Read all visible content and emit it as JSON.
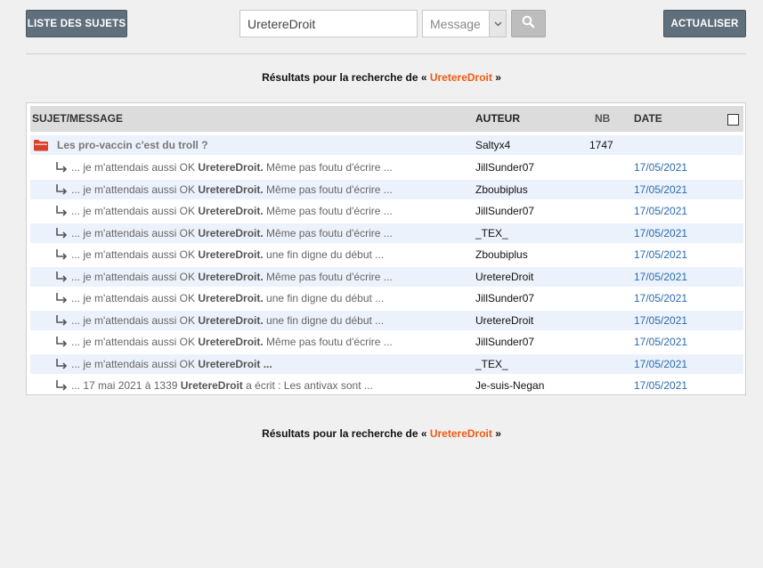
{
  "toolbar": {
    "list_button": "LISTE DES SUJETS",
    "refresh_button": "ACTUALISER",
    "search_value": "UretereDroit",
    "search_mode": "Message",
    "search_icon": "search-icon"
  },
  "results": {
    "prefix": "Résultats pour la recherche de « ",
    "term": "UretereDroit",
    "suffix": " »"
  },
  "table": {
    "headers": {
      "subject": "SUJET/MESSAGE",
      "author": "AUTEUR",
      "nb": "NB",
      "date": "DATE"
    },
    "topic": {
      "title": "Les pro-vaccin c'est du troll ?",
      "author": "Saltyx4",
      "nb": "1747"
    },
    "rows": [
      {
        "pre": "... je m'attendais aussi OK ",
        "bold": "UretereDroit.",
        "post": " Même pas foutu d'écrire ...",
        "author": "JillSunder07",
        "date": "17/05/2021"
      },
      {
        "pre": "... je m'attendais aussi OK ",
        "bold": "UretereDroit.",
        "post": " Même pas foutu d'écrire ...",
        "author": "Zboubiplus",
        "date": "17/05/2021"
      },
      {
        "pre": "... je m'attendais aussi OK ",
        "bold": "UretereDroit.",
        "post": " Même pas foutu d'écrire ...",
        "author": "JillSunder07",
        "date": "17/05/2021"
      },
      {
        "pre": "... je m'attendais aussi OK ",
        "bold": "UretereDroit.",
        "post": " Même pas foutu d'écrire ...",
        "author": "_TEX_",
        "date": "17/05/2021"
      },
      {
        "pre": "... je m'attendais aussi OK ",
        "bold": "UretereDroit.",
        "post": " une fin digne du début ...",
        "author": "Zboubiplus",
        "date": "17/05/2021"
      },
      {
        "pre": "... je m'attendais aussi OK ",
        "bold": "UretereDroit.",
        "post": " Même pas foutu d'écrire ...",
        "author": "UretereDroit",
        "date": "17/05/2021"
      },
      {
        "pre": "... je m'attendais aussi OK ",
        "bold": "UretereDroit.",
        "post": " une fin digne du début ...",
        "author": "JillSunder07",
        "date": "17/05/2021"
      },
      {
        "pre": "... je m'attendais aussi OK ",
        "bold": "UretereDroit.",
        "post": " une fin digne du début ...",
        "author": "UretereDroit",
        "date": "17/05/2021"
      },
      {
        "pre": "... je m'attendais aussi OK ",
        "bold": "UretereDroit.",
        "post": " Même pas foutu d'écrire ...",
        "author": "JillSunder07",
        "date": "17/05/2021"
      },
      {
        "pre": "... je m'attendais aussi OK ",
        "bold": "UretereDroit ...",
        "post": "",
        "author": "_TEX_",
        "date": "17/05/2021"
      },
      {
        "pre": "... 17 mai 2021 à 1339 ",
        "bold": "UretereDroit",
        "post": " a écrit : Les antivax sont ...",
        "author": "Je-suis-Negan",
        "date": "17/05/2021"
      }
    ]
  },
  "colors": {
    "accent": "#f05a14",
    "link": "#2a6aaf",
    "button": "#5f6f7c",
    "row_alt": "#ecf2fb",
    "folder": "#d9412b"
  }
}
